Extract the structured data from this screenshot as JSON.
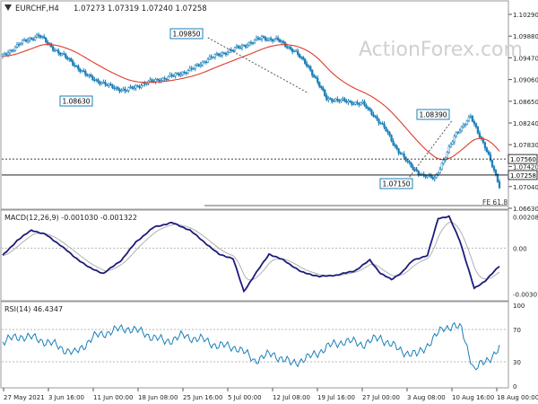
{
  "symbol_header": {
    "symbol": "EURCHF,H4",
    "ohlc": "1.07273 1.07319 1.07240 1.07258"
  },
  "watermark": "ActionForex.com",
  "fe_label": "FE 61.8",
  "colors": {
    "up": "#1a7fb8",
    "down": "#1a7fb8",
    "ma": "#e03a2a",
    "macd_line": "#1c1c7a",
    "macd_signal": "#b0b0b0",
    "rsi": "#1a7fb8",
    "grid": "#b8b8b8",
    "axis_text": "#222222",
    "current_price_tag": "#000000",
    "level_line": "#000000"
  },
  "chart_data": [
    {
      "type": "candlestick",
      "panel": "price",
      "title": "EURCHF,H4",
      "y_ticks": [
        "1.10290",
        "1.09880",
        "1.09470",
        "1.09060",
        "1.08650",
        "1.08240",
        "1.07830",
        "1.07420",
        "1.07040",
        "1.06630"
      ],
      "ylim": [
        1.0663,
        1.1029
      ],
      "x_ticks": [
        "27 May 2021",
        "3 Jun 16:00",
        "11 Jun 00:00",
        "18 Jun 08:00",
        "25 Jun 16:00",
        "5 Jul 00:00",
        "12 Jul 08:00",
        "19 Jul 16:00",
        "27 Jul 00:00",
        "3 Aug 08:00",
        "10 Aug 16:00",
        "18 Aug 00:00"
      ],
      "anchors": {
        "t": [
          0,
          10,
          20,
          28,
          38,
          46,
          58,
          68,
          80,
          92,
          105,
          114,
          126,
          134,
          144,
          153,
          162,
          170,
          180,
          190,
          200,
          206,
          213,
          218,
          226,
          233,
          240,
          246,
          252,
          260,
          268,
          276
        ],
        "v": [
          1.095,
          1.0975,
          1.099,
          1.0965,
          1.094,
          1.0915,
          1.0895,
          1.0885,
          1.09,
          1.091,
          1.0925,
          1.0945,
          1.096,
          1.097,
          1.0985,
          1.098,
          1.096,
          1.093,
          1.087,
          1.0865,
          1.086,
          1.084,
          1.081,
          1.078,
          1.0745,
          1.0725,
          1.072,
          1.076,
          1.0805,
          1.0835,
          1.078,
          1.0705
        ]
      },
      "current_price": "1.07258",
      "level_lines": [
        {
          "label": "1.07560",
          "value": 1.0756,
          "style": "dotted"
        },
        {
          "label": "1.07258",
          "value": 1.07258,
          "style": "solid"
        }
      ],
      "annotations": [
        {
          "label": "1.09850",
          "value": 1.0985
        },
        {
          "label": "1.08630",
          "value": 1.0863
        },
        {
          "label": "1.08390",
          "value": 1.0839
        },
        {
          "label": "1.07150",
          "value": 1.0715
        }
      ],
      "series": [
        {
          "name": "MA",
          "role": "moving-average"
        }
      ]
    },
    {
      "type": "line",
      "panel": "macd",
      "title": "MACD(12,26,9) -0.001030 -0.001322",
      "y_ticks": [
        "0.002081",
        "0.00",
        "-0.003079"
      ],
      "ylim": [
        -0.0034,
        0.0023
      ],
      "anchors": {
        "t": [
          0,
          8,
          16,
          24,
          32,
          40,
          48,
          56,
          66,
          74,
          84,
          94,
          104,
          112,
          120,
          128,
          134,
          140,
          148,
          156,
          166,
          176,
          186,
          196,
          204,
          210,
          216,
          222,
          228,
          236,
          242,
          248,
          254,
          262,
          268,
          276
        ],
        "v": [
          -0.0005,
          0.0005,
          0.0012,
          0.0009,
          0.0002,
          -0.0006,
          -0.0013,
          -0.0017,
          -0.0008,
          0.0004,
          0.0014,
          0.0017,
          0.0012,
          0.0004,
          -0.0004,
          -0.0007,
          -0.0029,
          -0.0018,
          -0.0004,
          -0.0008,
          -0.0016,
          -0.0019,
          -0.0018,
          -0.0015,
          -0.0008,
          -0.0017,
          -0.0021,
          -0.0016,
          -0.0008,
          -0.0005,
          0.002,
          0.0021,
          0.0005,
          -0.0027,
          -0.0022,
          -0.0012
        ]
      },
      "series": [
        {
          "name": "",
          "role": "macd"
        },
        {
          "name": "",
          "role": "signal"
        }
      ]
    },
    {
      "type": "line",
      "panel": "rsi",
      "title": "RSI(14) 46.4347",
      "y_ticks": [
        "100",
        "70",
        "30",
        "0"
      ],
      "ylim": [
        0,
        100
      ],
      "h_lines": [
        70,
        30
      ],
      "anchors": {
        "t": [
          0,
          10,
          20,
          30,
          40,
          50,
          60,
          70,
          80,
          90,
          100,
          110,
          120,
          130,
          140,
          150,
          160,
          170,
          180,
          190,
          200,
          210,
          220,
          230,
          240,
          245,
          250,
          255,
          262,
          268,
          276
        ],
        "v": [
          55,
          62,
          58,
          50,
          40,
          60,
          68,
          72,
          64,
          55,
          62,
          58,
          50,
          48,
          32,
          40,
          28,
          35,
          48,
          56,
          52,
          60,
          45,
          38,
          60,
          72,
          75,
          70,
          20,
          30,
          46
        ]
      }
    }
  ]
}
